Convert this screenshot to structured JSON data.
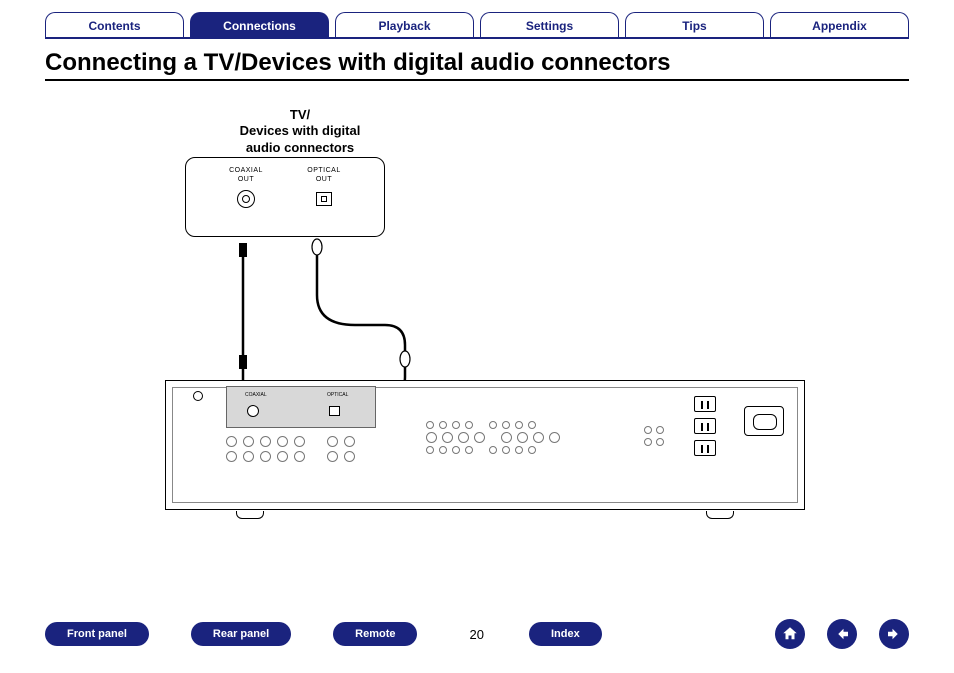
{
  "tabs": [
    {
      "label": "Contents",
      "active": false
    },
    {
      "label": "Connections",
      "active": true
    },
    {
      "label": "Playback",
      "active": false
    },
    {
      "label": "Settings",
      "active": false
    },
    {
      "label": "Tips",
      "active": false
    },
    {
      "label": "Appendix",
      "active": false
    }
  ],
  "title": "Connecting a TV/Devices with digital audio connectors",
  "device": {
    "label_line1": "TV/",
    "label_line2": "Devices with digital",
    "label_line3": "audio connectors",
    "ports": {
      "coaxial_line1": "COAXIAL",
      "coaxial_line2": "OUT",
      "optical_line1": "OPTICAL",
      "optical_line2": "OUT"
    }
  },
  "amp": {
    "digital": {
      "coaxial": "COAXIAL",
      "optical": "OPTICAL"
    }
  },
  "bottom": {
    "front": "Front panel",
    "rear": "Rear panel",
    "remote": "Remote",
    "index": "Index",
    "page": "20"
  }
}
